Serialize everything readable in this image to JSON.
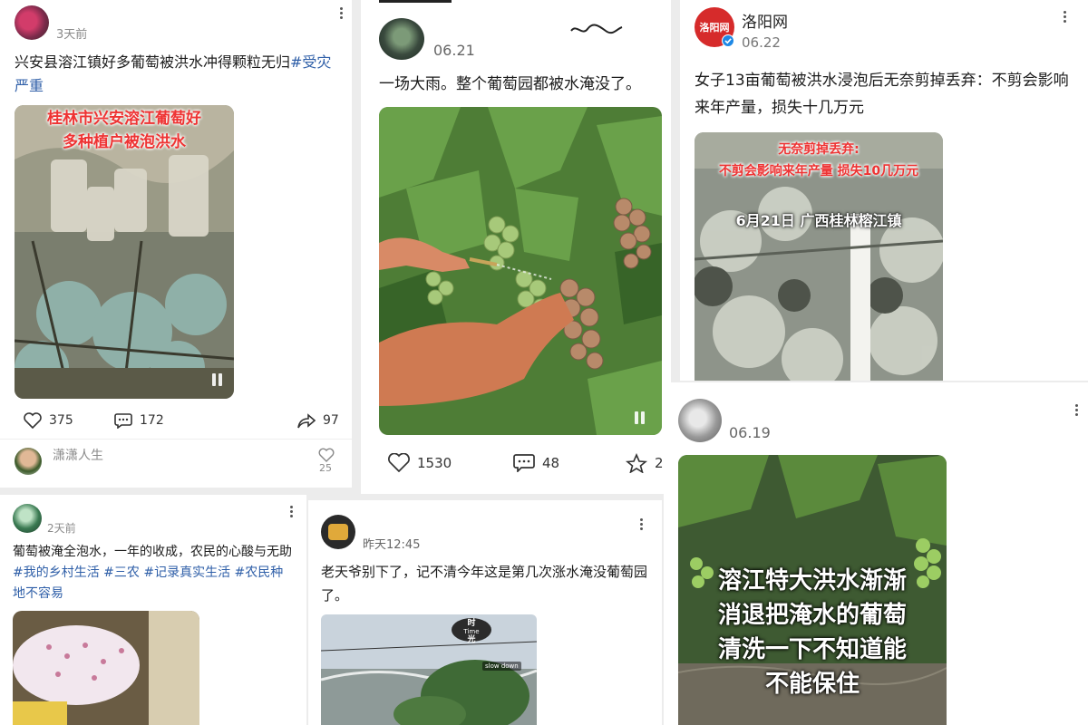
{
  "post1": {
    "time": "3天前",
    "text": "兴安县溶江镇好多葡萄被洪水冲得颗粒无归",
    "tag": "#受灾严重",
    "overlay_line1": "桂林市兴安溶江葡萄好",
    "overlay_line2": "多种植户被泡洪水",
    "likes": "375",
    "comments": "172",
    "shares": "97",
    "author": "潇潇人生",
    "side_likes": "25"
  },
  "post2": {
    "date": "06.21",
    "text": "一场大雨。整个葡萄园都被水淹没了。",
    "likes": "1530",
    "comments": "48",
    "stars": "2"
  },
  "post3": {
    "author": "洛阳网",
    "date": "06.22",
    "text": "女子13亩葡萄被洪水浸泡后无奈剪掉丢弃：不剪会影响来年产量，损失十几万元",
    "overlay_line1": "无奈剪掉丢弃:",
    "overlay_line2": "不剪会影响来年产量 损失10几万元",
    "overlay_line3": "6月21日 广西桂林榕江镇",
    "logo_text": "洛阳网"
  },
  "post4": {
    "date": "06.19",
    "overlay": [
      "溶江特大洪水渐渐",
      "消退把淹水的葡萄",
      "清洗一下不知道能",
      "不能保住"
    ]
  },
  "post5": {
    "time": "2天前",
    "text": "葡萄被淹全泡水，一年的收成，农民的心酸与无助",
    "tags": "#我的乡村生活 #三农 #记录真实生活 #农民种地不容易"
  },
  "post6": {
    "time": "昨天12:45",
    "text": "老天爷别下了，记不清今年这是第几次涨水淹没葡萄园了。",
    "badge_top": "时",
    "badge_mid": "Time",
    "badge_bottom": "光",
    "slow_label": "slow down"
  },
  "colors": {
    "tag_blue": "#2f5fa8",
    "overlay_red": "#e33333",
    "verified_blue": "#1e88e5",
    "logo_red": "#d62b2b"
  }
}
